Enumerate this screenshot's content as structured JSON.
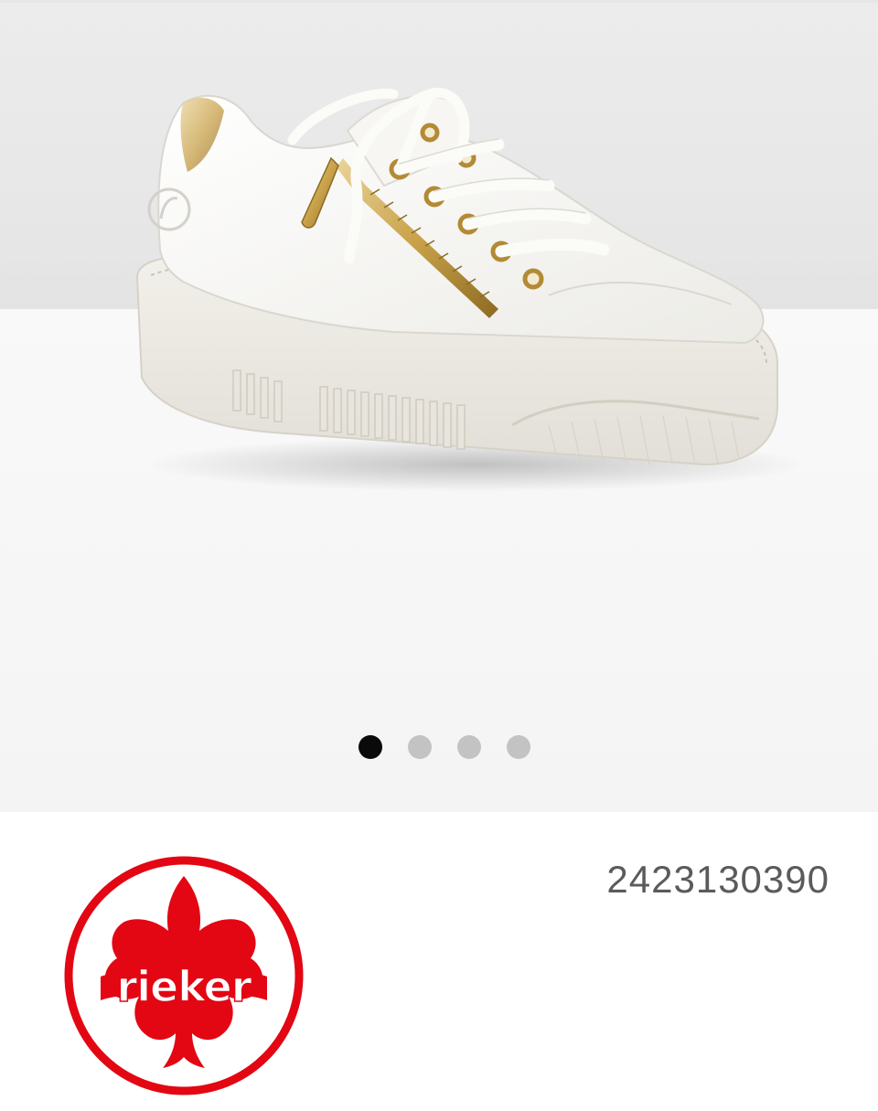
{
  "product": {
    "article_number": "2423130390",
    "image_icon": "white-sneaker-with-gold-zipper-image"
  },
  "gallery": {
    "slide_count": 4,
    "active_index": 0,
    "dot_active_color": "#0a0a0a",
    "dot_inactive_color": "#c3c3c3"
  },
  "brand": {
    "name": "rieker",
    "logo_icon": "rieker-fleur-de-lis-logo",
    "logo_color": "#e30613"
  }
}
